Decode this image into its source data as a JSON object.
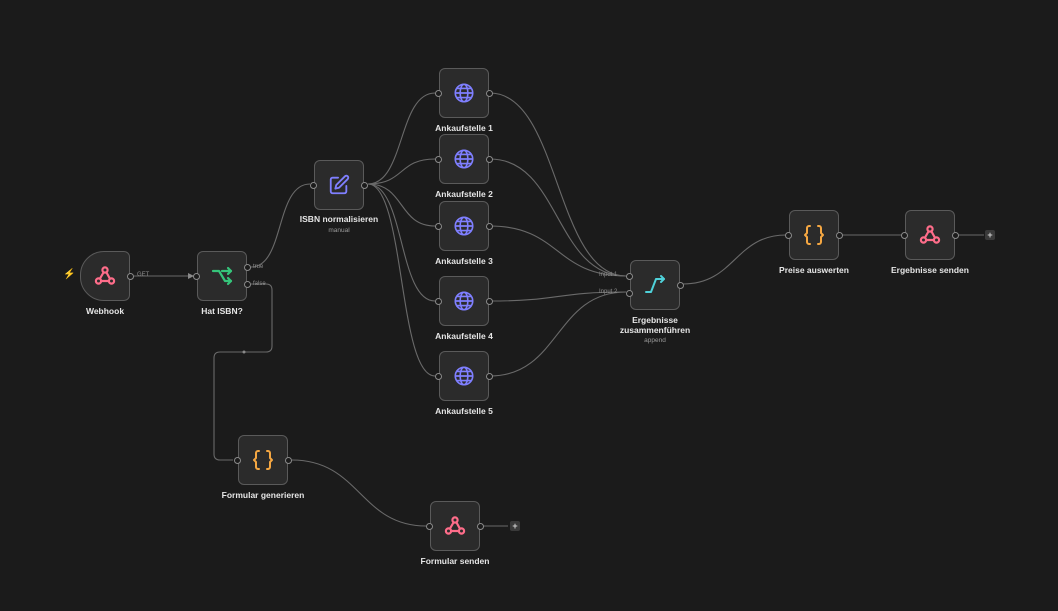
{
  "workflow": {
    "trigger_icon": "bolt-icon",
    "nodes": {
      "webhook": {
        "name": "Webhook",
        "icon": "webhook-icon",
        "method": "GET"
      },
      "hat_isbn": {
        "name": "Hat ISBN?",
        "icon": "if-branch-icon",
        "true_label": "true",
        "false_label": "false"
      },
      "isbn": {
        "name": "ISBN normalisieren",
        "subtitle": "manual",
        "icon": "edit-icon"
      },
      "a1": {
        "name": "Ankaufstelle 1",
        "icon": "globe-icon"
      },
      "a2": {
        "name": "Ankaufstelle 2",
        "icon": "globe-icon"
      },
      "a3": {
        "name": "Ankaufstelle 3",
        "icon": "globe-icon"
      },
      "a4": {
        "name": "Ankaufstelle 4",
        "icon": "globe-icon"
      },
      "a5": {
        "name": "Ankaufstelle 5",
        "icon": "globe-icon"
      },
      "merge": {
        "name_line1": "Ergebnisse",
        "name_line2": "zusammenführen",
        "subtitle": "append",
        "input1": "Input 1",
        "input2": "Input 2",
        "icon": "merge-icon"
      },
      "preise": {
        "name": "Preise auswerten",
        "icon": "code-braces-icon"
      },
      "ergebnisse_senden": {
        "name": "Ergebnisse senden",
        "icon": "webhook-icon"
      },
      "formular_generieren": {
        "name": "Formular generieren",
        "icon": "code-braces-icon"
      },
      "formular_senden": {
        "name": "Formular senden",
        "icon": "webhook-icon"
      }
    },
    "add_button": "+"
  },
  "colors": {
    "background": "#1b1b1b",
    "webhook": "#ff6d8a",
    "if": "#35c47a",
    "globe": "#7f7fff",
    "code": "#f5a742",
    "merge": "#4fd1d9"
  }
}
